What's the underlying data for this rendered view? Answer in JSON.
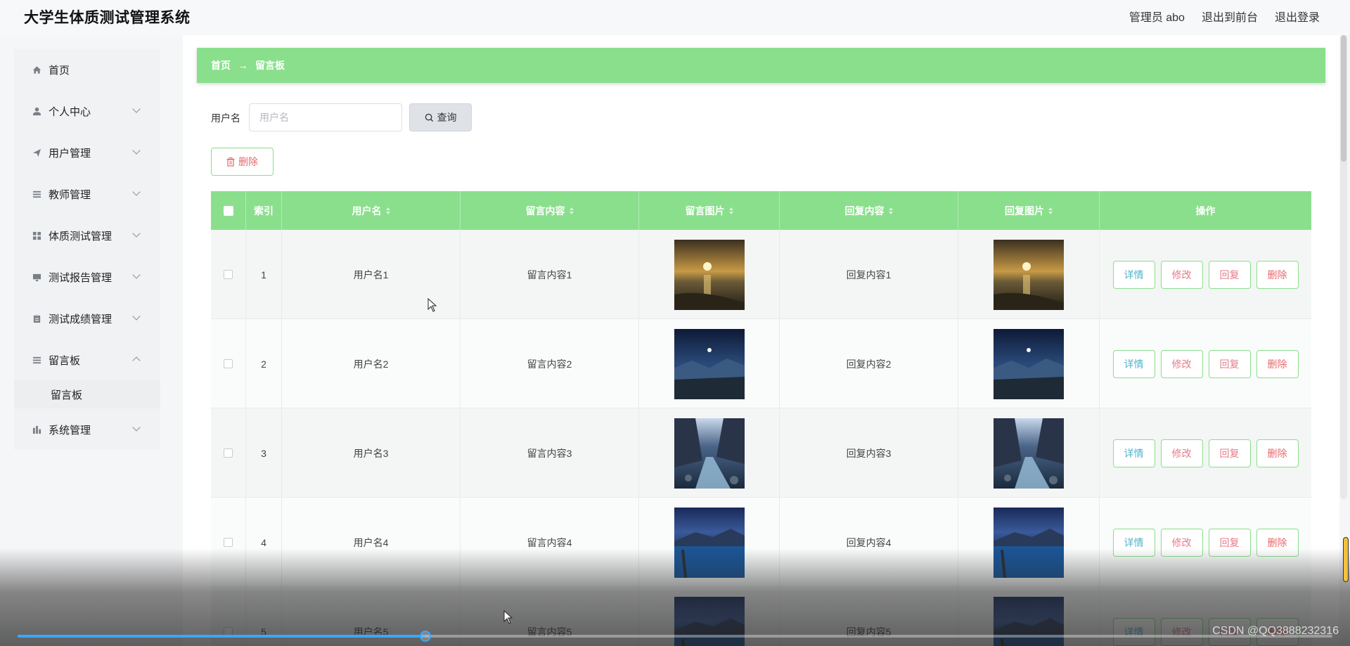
{
  "app": {
    "title": "大学生体质测试管理系统",
    "links": [
      "管理员 abo",
      "退出到前台",
      "退出登录"
    ]
  },
  "sidebar": {
    "items": [
      {
        "label": "首页",
        "icon": "home-icon",
        "expand": false
      },
      {
        "label": "个人中心",
        "icon": "user-icon",
        "expand": true
      },
      {
        "label": "用户管理",
        "icon": "send-icon",
        "expand": true
      },
      {
        "label": "教师管理",
        "icon": "list-icon",
        "expand": true
      },
      {
        "label": "体质测试管理",
        "icon": "grid-icon",
        "expand": true
      },
      {
        "label": "测试报告管理",
        "icon": "monitor-icon",
        "expand": true
      },
      {
        "label": "测试成绩管理",
        "icon": "clipboard-icon",
        "expand": true
      },
      {
        "label": "留言板",
        "icon": "list-icon",
        "expand": true
      },
      {
        "label": "系统管理",
        "icon": "bar-chart-icon",
        "expand": true
      }
    ],
    "submenu": {
      "label": "留言板"
    }
  },
  "breadcrumb": {
    "home": "首页",
    "arrow": "→",
    "current": "留言板"
  },
  "search": {
    "label": "用户名",
    "placeholder": "用户名",
    "button": "查询"
  },
  "toolbar": {
    "delete": "删除"
  },
  "table": {
    "columns": [
      "索引",
      "用户名",
      "留言内容",
      "留言图片",
      "回复内容",
      "回复图片",
      "操作"
    ],
    "actions": [
      "详情",
      "修改",
      "回复",
      "删除"
    ],
    "rows": [
      {
        "index": "1",
        "username": "用户名1",
        "message": "留言内容1",
        "reply": "回复内容1",
        "image": "sunset-beach-image"
      },
      {
        "index": "2",
        "username": "用户名2",
        "message": "留言内容2",
        "reply": "回复内容2",
        "image": "night-valley-image"
      },
      {
        "index": "3",
        "username": "用户名3",
        "message": "留言内容3",
        "reply": "回复内容3",
        "image": "mountain-river-image"
      },
      {
        "index": "4",
        "username": "用户名4",
        "message": "留言内容4",
        "reply": "回复内容4",
        "image": "blue-lake-image"
      },
      {
        "index": "5",
        "username": "用户名5",
        "message": "留言内容5",
        "reply": "回复内容5",
        "image": "blue-lake-image"
      }
    ]
  },
  "player": {
    "progress": 0.31,
    "watermark": "CSDN @QQ3888232316"
  },
  "colors": {
    "accent": "#8adf8c",
    "danger": "#e8686a",
    "info": "#4fb3c9"
  }
}
